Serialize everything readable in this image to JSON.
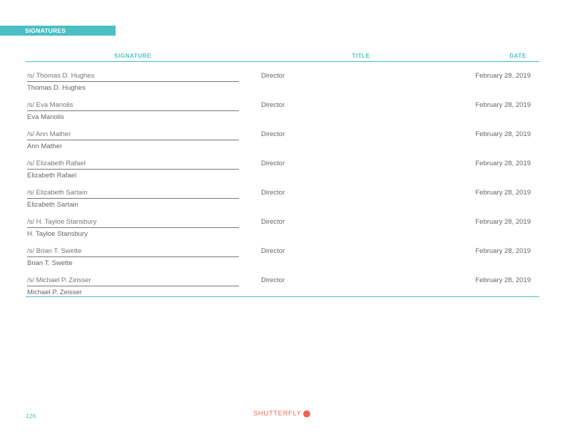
{
  "section_label": "SIGNATURES",
  "table": {
    "headers": {
      "signature": "SIGNATURE",
      "title": "TITLE",
      "date": "DATE"
    },
    "rows": [
      {
        "signature": "/s/ Thomas D. Hughes",
        "name": "Thomas D. Hughes",
        "title": "Director",
        "date": "February 28, 2019"
      },
      {
        "signature": "/s/ Eva Manolis",
        "name": "Eva Manolis",
        "title": "Director",
        "date": "February 28, 2019"
      },
      {
        "signature": "/s/ Ann Mather",
        "name": "Ann Mather",
        "title": "Director",
        "date": "February 28, 2019"
      },
      {
        "signature": "/s/ Elizabeth Rafael",
        "name": "Elizabeth Rafael",
        "title": "Director",
        "date": "February 28, 2019"
      },
      {
        "signature": "/s/ Elizabeth Sartain",
        "name": "Elizabeth Sartain",
        "title": "Director",
        "date": "February 28, 2019"
      },
      {
        "signature": "/s/ H. Tayloe Stansbury",
        "name": "H. Tayloe Stansbury",
        "title": "Director",
        "date": "February 28, 2019"
      },
      {
        "signature": "/s/ Brian T. Swette",
        "name": "Brian T. Swette",
        "title": "Director",
        "date": "February 28, 2019"
      },
      {
        "signature": "/s/ Michael P. Zeisser",
        "name": "Michael P. Zeisser",
        "title": "Director",
        "date": "February 28, 2019"
      }
    ]
  },
  "footer": {
    "page_number": "126",
    "logo_text": "SHUTTERFLY",
    "logo_icon": "shutterfly-badge-icon"
  },
  "colors": {
    "accent_teal": "#4bbfc4",
    "brand_orange": "#f0664f",
    "text_gray": "#666666"
  }
}
